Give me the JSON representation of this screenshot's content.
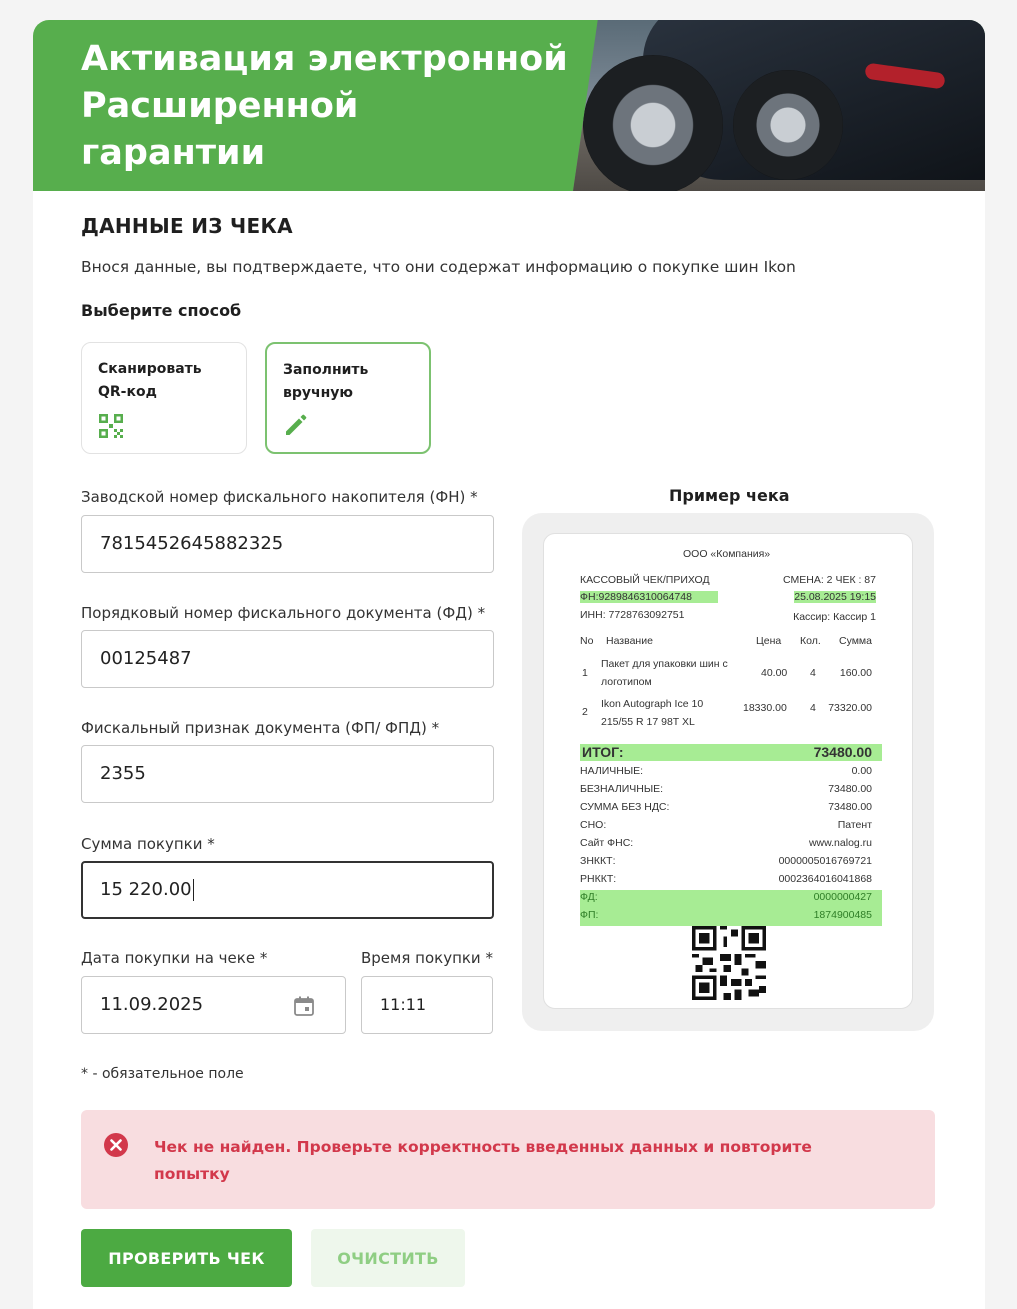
{
  "hero": {
    "title": "Активация электронной\nРасширенной\nгарантии"
  },
  "section": {
    "title": "ДАННЫЕ ИЗ ЧЕКА",
    "subtitle": "Внося данные, вы подтверждаете, что они содержат информацию о покупке шин Ikon"
  },
  "method": {
    "label": "Выберите способ",
    "options": [
      {
        "label": "Сканировать\nQR-код",
        "icon": "qr-code-icon",
        "selected": false
      },
      {
        "label": "Заполнить\nвручную",
        "icon": "pencil-icon",
        "selected": true
      }
    ]
  },
  "form": {
    "fn_label": "Заводской номер фискального накопителя (ФН) *",
    "fn_value": "7815452645882325",
    "fd_label": "Порядковый номер фискального документа (ФД) *",
    "fd_value": "00125487",
    "fp_label": "Фискальный признак документа (ФП/ ФПД) *",
    "fp_value": "2355",
    "sum_label": "Сумма покупки *",
    "sum_value": "15 220.00",
    "date_label": "Дата покупки на чеке *",
    "date_value": "11.09.2025",
    "time_label": "Время покупки *",
    "time_value": "11:11",
    "required_note": "* - обязательное поле"
  },
  "example": {
    "title": "Пример чека",
    "receipt": {
      "company": "ООО «Компания»",
      "type": "КАССОВЫЙ ЧЕК/ПРИХОД",
      "shift": "СМЕНА: 2  ЧЕК : 87",
      "fn": "ФН:9289846310064748",
      "datetime": "25.08.2025 19:15",
      "inn": "ИНН: 7728763092751",
      "cashier": "Кассир: Кассир 1",
      "headers": {
        "no": "No",
        "name": "Название",
        "price": "Цена",
        "qty": "Кол.",
        "sum": "Сумма"
      },
      "items": [
        {
          "no": "1",
          "name1": "Пакет для упаковки шин с",
          "name2": "логотипом",
          "price": "40.00",
          "qty": "4",
          "sum": "160.00"
        },
        {
          "no": "2",
          "name1": "Ikon Autograph Ice 10",
          "name2": "215/55 R 17 98T XL",
          "price": "18330.00",
          "qty": "4",
          "sum": "73320.00"
        }
      ],
      "total_label": "ИТОГ:",
      "total_value": "73480.00",
      "rows": [
        {
          "label": "НАЛИЧНЫЕ:",
          "value": "0.00"
        },
        {
          "label": "БЕЗНАЛИЧНЫЕ:",
          "value": "73480.00"
        },
        {
          "label": "СУММА БЕЗ НДС:",
          "value": "73480.00"
        },
        {
          "label": "СНО:",
          "value": "Патент"
        },
        {
          "label": "Сайт ФНС:",
          "value": "www.nalog.ru"
        },
        {
          "label": "ЗНККТ:",
          "value": "0000005016769721"
        },
        {
          "label": "РНККТ:",
          "value": "0002364016041868"
        }
      ],
      "fd_label": "ФД:",
      "fd_value": "0000000427",
      "fp_label": "ФП:",
      "fp_value": "1874900485"
    }
  },
  "alert": {
    "icon": "error-icon",
    "text": "Чек не найден. Проверьте корректность введенных данных и повторите попытку"
  },
  "buttons": {
    "check": "ПРОВЕРИТЬ ЧЕК",
    "clear": "ОЧИСТИТЬ"
  },
  "colors": {
    "brand_green": "#57ae4d",
    "button_green": "#4caa42",
    "error_red": "#d2384b",
    "alert_bg": "#f8dde0",
    "highlight": "#a7ec94"
  }
}
